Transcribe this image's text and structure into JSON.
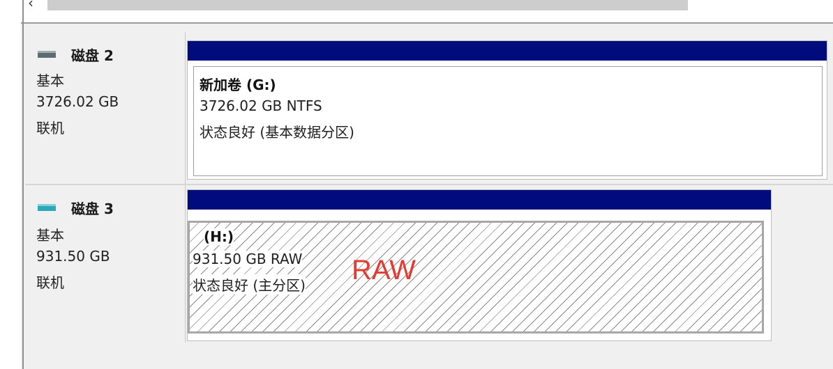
{
  "disks": [
    {
      "name": "磁盘 2",
      "type": "基本",
      "size": "3726.02 GB",
      "status": "联机",
      "icon": "disk-drive-icon",
      "icon_color": "#5d6b73",
      "volume": {
        "label": "新加卷 (G:)",
        "size_fs": "3726.02 GB NTFS",
        "health": "状态良好 (基本数据分区)"
      }
    },
    {
      "name": "磁盘 3",
      "type": "基本",
      "size": "931.50 GB",
      "status": "联机",
      "icon": "disk-drive-icon",
      "icon_color": "#2aa9b8",
      "volume": {
        "label": "(H:)",
        "size_fs": "931.50 GB RAW",
        "health": "状态良好 (主分区)",
        "annotation": "RAW"
      }
    }
  ],
  "colors": {
    "partition_header": "#000b7c",
    "annotation": "#e23b32"
  }
}
